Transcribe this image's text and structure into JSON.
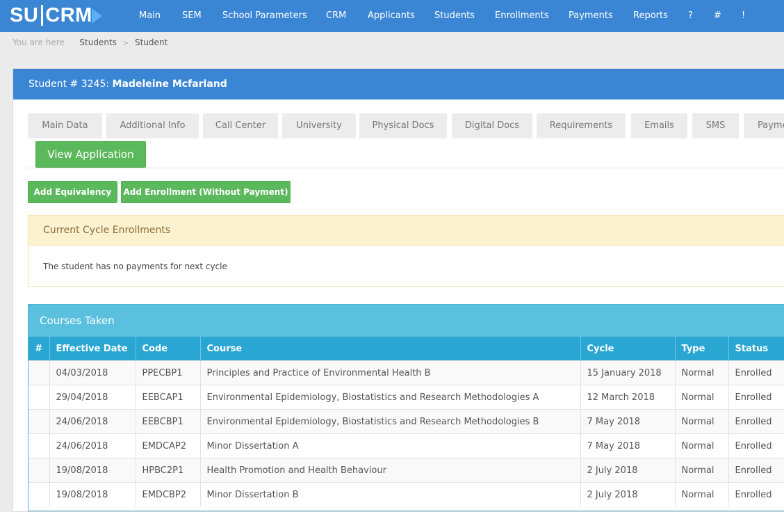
{
  "app": {
    "logo_left": "SU",
    "logo_right": "CRM",
    "nav": [
      "Main",
      "SEM",
      "School Parameters",
      "CRM",
      "Applicants",
      "Students",
      "Enrollments",
      "Payments",
      "Reports",
      "?",
      "#",
      "!"
    ]
  },
  "breadcrumb": {
    "prefix": "You are here",
    "items": [
      "Students",
      "Student"
    ]
  },
  "student": {
    "number_label": "Student # 3245:",
    "name": "Madeleine Mcfarland"
  },
  "tabs": [
    "Main Data",
    "Additional Info",
    "Call Center",
    "University",
    "Physical Docs",
    "Digital Docs",
    "Requirements",
    "Emails",
    "SMS",
    "Payme"
  ],
  "actions": {
    "view_application": "View Application",
    "add_equivalency": "Add Equivalency",
    "add_enrollment": "Add Enrollment (Without Payment)"
  },
  "current_cycle": {
    "title": "Current Cycle Enrollments",
    "message": "The student has no payments for next cycle"
  },
  "courses": {
    "title": "Courses Taken",
    "columns": [
      "#",
      "Effective Date",
      "Code",
      "Course",
      "Cycle",
      "Type",
      "Status"
    ],
    "rows": [
      [
        "",
        "04/03/2018",
        "PPECBP1",
        "Principles and Practice of Environmental Health B",
        "15 January 2018",
        "Normal",
        "Enrolled"
      ],
      [
        "",
        "29/04/2018",
        "EEBCAP1",
        "Environmental Epidemiology, Biostatistics and Research Methodologies A",
        "12 March 2018",
        "Normal",
        "Enrolled"
      ],
      [
        "",
        "24/06/2018",
        "EEBCBP1",
        "Environmental Epidemiology, Biostatistics and Research Methodologies B",
        "7 May 2018",
        "Normal",
        "Enrolled"
      ],
      [
        "",
        "24/06/2018",
        "EMDCAP2",
        "Minor Dissertation A",
        "7 May 2018",
        "Normal",
        "Enrolled"
      ],
      [
        "",
        "19/08/2018",
        "HPBC2P1",
        "Health Promotion and Health Behaviour",
        "2 July 2018",
        "Normal",
        "Enrolled"
      ],
      [
        "",
        "19/08/2018",
        "EMDCBP2",
        "Minor Dissertation B",
        "2 July 2018",
        "Normal",
        "Enrolled"
      ]
    ]
  },
  "colors": {
    "nav_bg": "#3a86d4",
    "panel_head": "#3a86d4",
    "green": "#5cb85c",
    "warning_bg": "#fcf2cf",
    "info_head": "#5bc0de",
    "table_head": "#2aa6d3"
  }
}
